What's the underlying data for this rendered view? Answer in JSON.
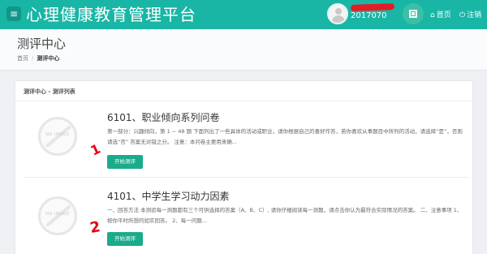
{
  "topbar": {
    "menu_icon": "hamburger-icon",
    "app_title": "心理健康教育管理平台",
    "user": {
      "username": "2017070"
    },
    "qr_icon": "qr-code-icon",
    "home_label": "首页",
    "logout_label": "注销"
  },
  "page": {
    "title": "测评中心",
    "breadcrumb": [
      "首页",
      "测评中心"
    ]
  },
  "panel": {
    "heading": "测评中心 - 测评列表",
    "items": [
      {
        "thumbnail": "NO IMAGE",
        "title": "6101、职业倾向系列问卷",
        "description": "第一部分：兴趣倾向，第 1 ~ 48 题 下面列出了一些具体的活动或职业，请你根据自己的喜好作答，若你喜欢从事题目中所列的活动，请选择“是”，否则请选“否” 答案无对错之分。 注意：本问卷主要用来确...",
        "button_label": "开始测评"
      },
      {
        "thumbnail": "NO IMAGE",
        "title": "4101、中学生学习动力因素",
        "description": "一、回答方法 本测验每一测题都有三个可供选择的答案（A、B、C）, 请你仔细阅读每一测题，请点击你认为最符合实际情况的答案。 二、注意事项 1、按你平时所想的如实回答。 2、每一问题...",
        "button_label": "开始测评"
      }
    ]
  },
  "annotations": [
    "1",
    "2"
  ],
  "colors": {
    "topbar": "#19b6a6",
    "button": "#1aab8a",
    "annotation": "#e60012"
  }
}
